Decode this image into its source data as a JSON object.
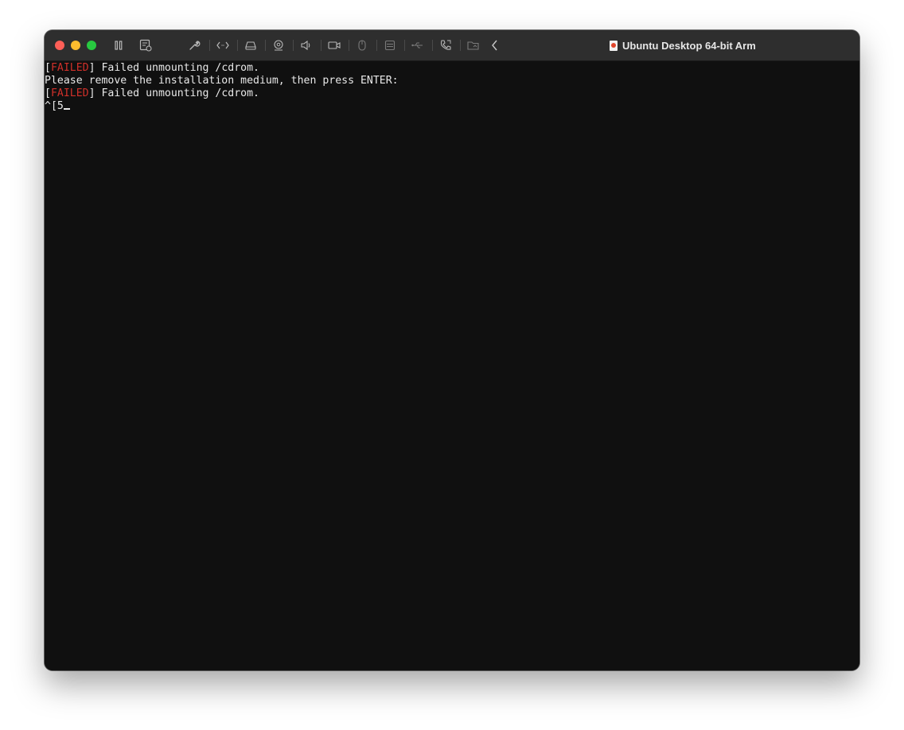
{
  "window": {
    "title": "Ubuntu Desktop 64-bit Arm",
    "accent_colors": {
      "close": "#fe5f57",
      "minimize": "#febc2e",
      "zoom": "#28c840",
      "failed_text": "#d0302a"
    }
  },
  "toolbar": {
    "icons": [
      "pause-icon",
      "snapshot-icon",
      "settings-wrench-icon",
      "code-icon",
      "hard-disk-icon",
      "camera-icon",
      "audio-icon",
      "video-camera-icon",
      "mouse-icon",
      "network-icon",
      "usb-icon",
      "phone-icon",
      "shared-folder-icon",
      "chevron-left-icon"
    ]
  },
  "terminal": {
    "lines": [
      {
        "bracket_open": "[",
        "status": "FAILED",
        "bracket_close": "]",
        "text": " Failed unmounting /cdrom."
      },
      {
        "text": "Please remove the installation medium, then press ENTER:"
      },
      {
        "bracket_open": "[",
        "status": "FAILED",
        "bracket_close": "]",
        "text": " Failed unmounting /cdrom."
      },
      {
        "text": "^[5"
      }
    ]
  }
}
